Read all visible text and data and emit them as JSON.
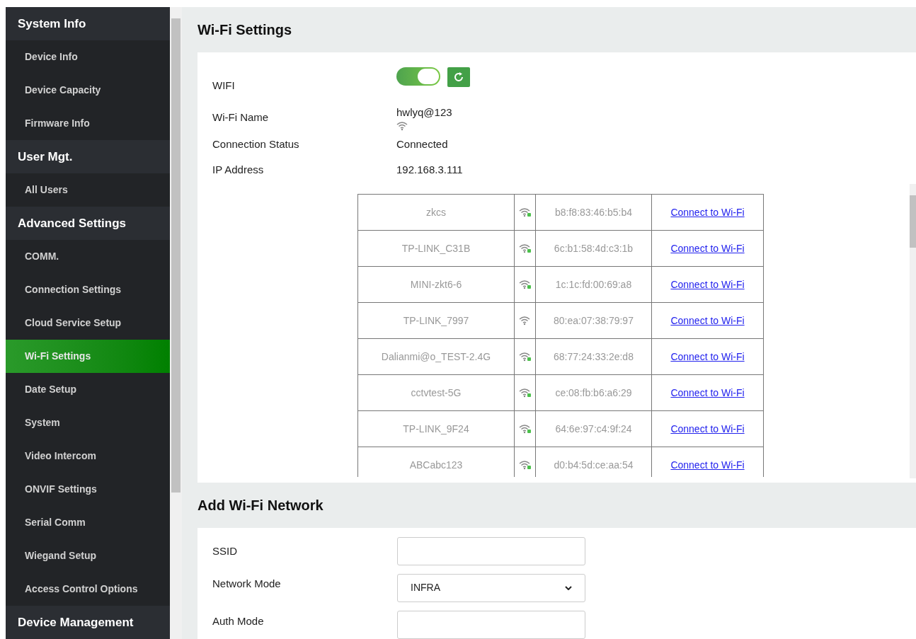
{
  "sidebar": {
    "groups": [
      {
        "title": "System Info",
        "items": [
          {
            "label": "Device Info",
            "selected": false
          },
          {
            "label": "Device Capacity",
            "selected": false
          },
          {
            "label": "Firmware Info",
            "selected": false
          }
        ]
      },
      {
        "title": "User Mgt.",
        "items": [
          {
            "label": "All Users",
            "selected": false
          }
        ]
      },
      {
        "title": "Advanced Settings",
        "items": [
          {
            "label": "COMM.",
            "selected": false
          },
          {
            "label": "Connection Settings",
            "selected": false
          },
          {
            "label": "Cloud Service Setup",
            "selected": false
          },
          {
            "label": "Wi-Fi Settings",
            "selected": true
          },
          {
            "label": "Date Setup",
            "selected": false
          },
          {
            "label": "System",
            "selected": false
          },
          {
            "label": "Video Intercom",
            "selected": false
          },
          {
            "label": "ONVIF Settings",
            "selected": false
          },
          {
            "label": "Serial Comm",
            "selected": false
          },
          {
            "label": "Wiegand Setup",
            "selected": false
          },
          {
            "label": "Access Control Options",
            "selected": false
          }
        ]
      },
      {
        "title": "Device Management"
      }
    ]
  },
  "wifi_settings": {
    "title": "Wi-Fi Settings",
    "wifi": {
      "label": "WIFI",
      "on": true
    },
    "wifi_name": {
      "label": "Wi-Fi Name",
      "value": "hwlyq@123"
    },
    "connection_status": {
      "label": "Connection Status",
      "value": "Connected"
    },
    "ip_address": {
      "label": "IP Address",
      "value": "192.168.3.111"
    },
    "networks": [
      {
        "ssid": "zkcs",
        "locked": true,
        "mac": "b8:f8:83:46:b5:b4",
        "action": "Connect to Wi-Fi"
      },
      {
        "ssid": "TP-LINK_C31B",
        "locked": true,
        "mac": "6c:b1:58:4d:c3:1b",
        "action": "Connect to Wi-Fi"
      },
      {
        "ssid": "MINI-zkt6-6",
        "locked": true,
        "mac": "1c:1c:fd:00:69:a8",
        "action": "Connect to Wi-Fi"
      },
      {
        "ssid": "TP-LINK_7997",
        "locked": false,
        "mac": "80:ea:07:38:79:97",
        "action": "Connect to Wi-Fi"
      },
      {
        "ssid": "Dalianmi@o_TEST-2.4G",
        "locked": true,
        "mac": "68:77:24:33:2e:d8",
        "action": "Connect to Wi-Fi"
      },
      {
        "ssid": "cctvtest-5G",
        "locked": true,
        "mac": "ce:08:fb:b6:a6:29",
        "action": "Connect to Wi-Fi"
      },
      {
        "ssid": "TP-LINK_9F24",
        "locked": true,
        "mac": "64:6e:97:c4:9f:24",
        "action": "Connect to Wi-Fi"
      },
      {
        "ssid": "ABCabc123",
        "locked": true,
        "mac": "d0:b4:5d:ce:aa:54",
        "action": "Connect to Wi-Fi"
      }
    ]
  },
  "add_network": {
    "title": "Add Wi-Fi Network",
    "ssid": {
      "label": "SSID"
    },
    "network_mode": {
      "label": "Network Mode",
      "value": "INFRA"
    },
    "auth_mode": {
      "label": "Auth Mode"
    }
  }
}
